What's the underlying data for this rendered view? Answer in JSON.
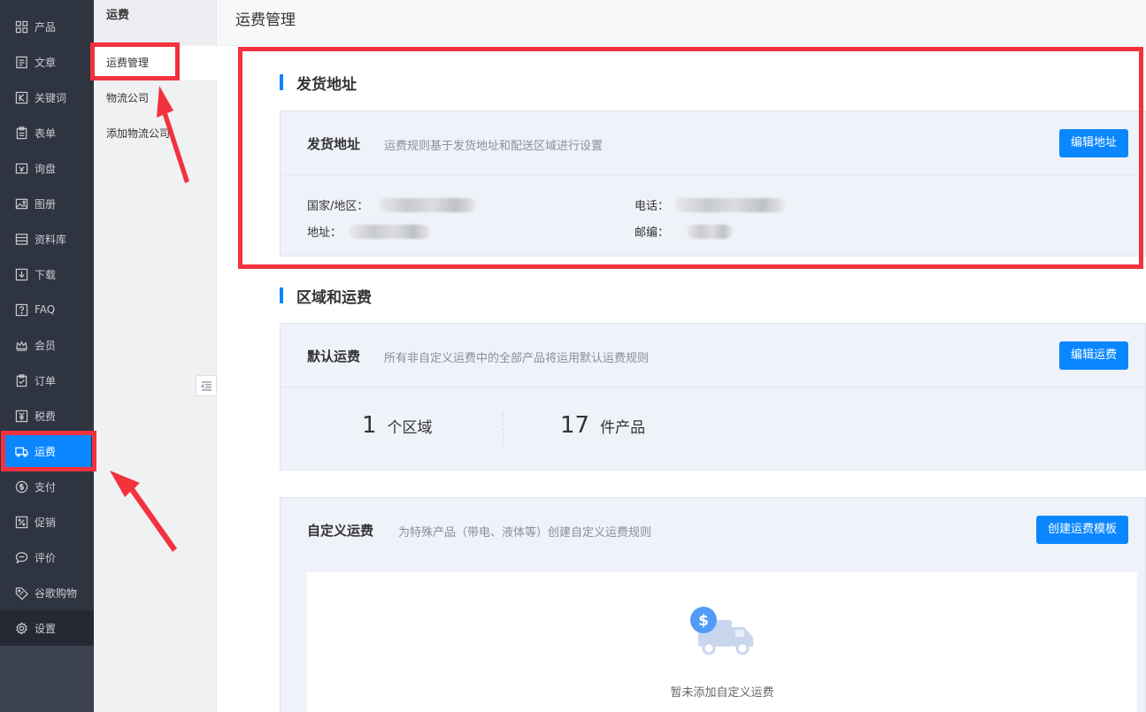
{
  "sidebar": {
    "items": [
      {
        "label": "产品",
        "icon": "grid-icon"
      },
      {
        "label": "文章",
        "icon": "document-icon"
      },
      {
        "label": "关键词",
        "icon": "keyword-icon"
      },
      {
        "label": "表单",
        "icon": "clipboard-icon"
      },
      {
        "label": "询盘",
        "icon": "inquiry-icon"
      },
      {
        "label": "图册",
        "icon": "image-icon"
      },
      {
        "label": "资料库",
        "icon": "library-icon"
      },
      {
        "label": "下载",
        "icon": "download-icon"
      },
      {
        "label": "FAQ",
        "icon": "faq-icon"
      },
      {
        "label": "会员",
        "icon": "crown-icon"
      },
      {
        "label": "订单",
        "icon": "order-icon"
      },
      {
        "label": "税费",
        "icon": "tax-icon"
      },
      {
        "label": "运费",
        "icon": "truck-icon"
      },
      {
        "label": "支付",
        "icon": "payment-icon"
      },
      {
        "label": "促销",
        "icon": "promotion-icon"
      },
      {
        "label": "评价",
        "icon": "comment-icon"
      },
      {
        "label": "谷歌购物",
        "icon": "tag-icon"
      },
      {
        "label": "设置",
        "icon": "gear-icon"
      }
    ],
    "active_index": 12
  },
  "submenu": {
    "title": "运费",
    "items": [
      "运费管理",
      "物流公司",
      "添加物流公司"
    ]
  },
  "page": {
    "title": "运费管理"
  },
  "shipping_address": {
    "section_title": "发货地址",
    "card_title": "发货地址",
    "card_desc": "运费规则基于发货地址和配送区域进行设置",
    "edit_button": "编辑地址",
    "country_label": "国家/地区：",
    "address_label": "地址：",
    "phone_label": "电话：",
    "zip_label": "邮编："
  },
  "zones": {
    "section_title": "区域和运费",
    "default": {
      "title": "默认运费",
      "desc": "所有非自定义运费中的全部产品将运用默认运费规则",
      "edit_button": "编辑运费",
      "zone_count": "1",
      "zone_unit": "个区域",
      "product_count": "17",
      "product_unit": "件产品"
    },
    "custom": {
      "title": "自定义运费",
      "desc": "为特殊产品（带电、液体等）创建自定义运费规则",
      "create_button": "创建运费模板",
      "empty_text": "暂未添加自定义运费"
    }
  },
  "colors": {
    "accent": "#0a87ff",
    "sidebar_bg": "#2f3441",
    "annotation": "#f2323d"
  }
}
